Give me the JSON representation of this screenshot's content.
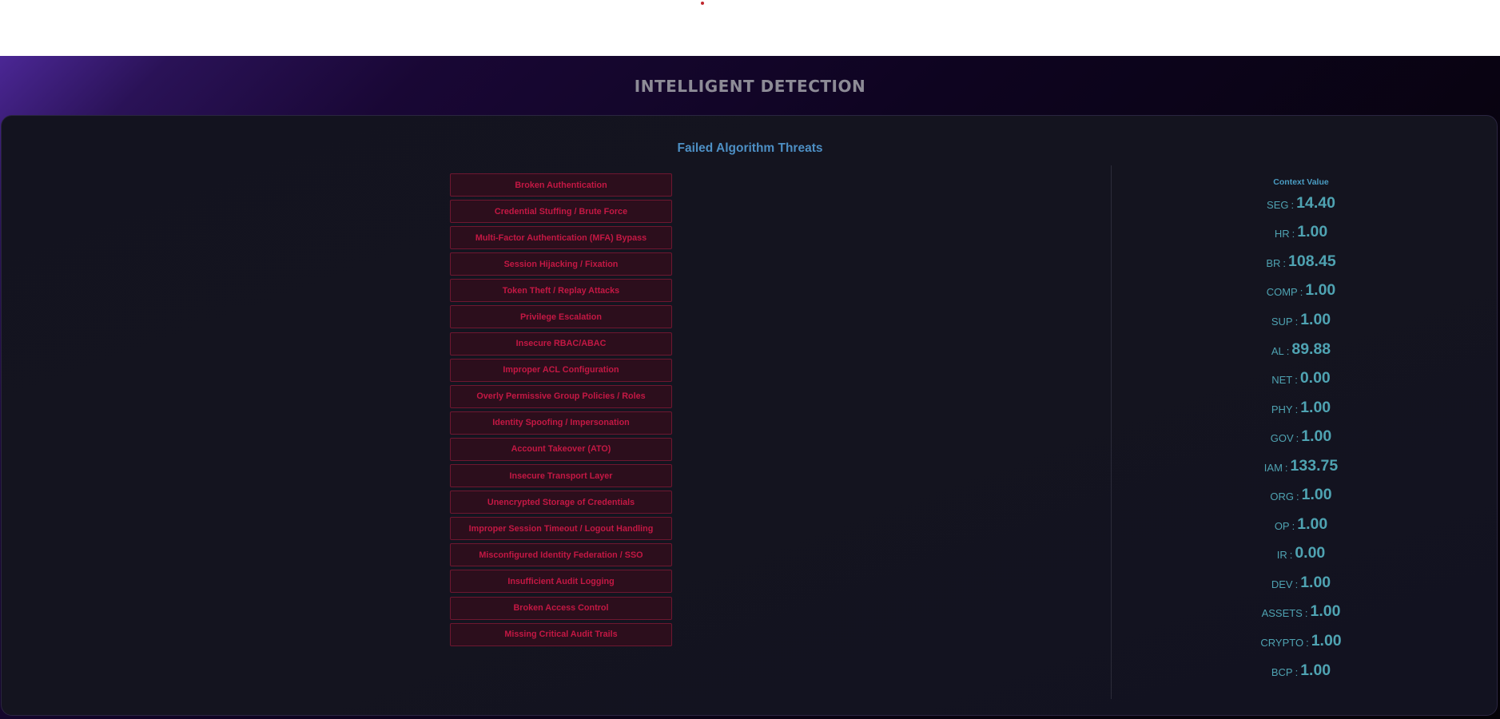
{
  "header": {
    "section_title": "INTELLIGENT DETECTION"
  },
  "panel": {
    "title": "Failed Algorithm Threats",
    "threats": [
      "Broken Authentication",
      "Credential Stuffing / Brute Force",
      "Multi-Factor Authentication (MFA) Bypass",
      "Session Hijacking / Fixation",
      "Token Theft / Replay Attacks",
      "Privilege Escalation",
      "Insecure RBAC/ABAC",
      "Improper ACL Configuration",
      "Overly Permissive Group Policies / Roles",
      "Identity Spoofing / Impersonation",
      "Account Takeover (ATO)",
      "Insecure Transport Layer",
      "Unencrypted Storage of Credentials",
      "Improper Session Timeout / Logout Handling",
      "Misconfigured Identity Federation / SSO",
      "Insufficient Audit Logging",
      "Broken Access Control",
      "Missing Critical Audit Trails"
    ],
    "context": {
      "header": "Context Value",
      "separator": ":",
      "items": [
        {
          "key": "SEG",
          "value": "14.40"
        },
        {
          "key": "HR",
          "value": "1.00"
        },
        {
          "key": "BR",
          "value": "108.45"
        },
        {
          "key": "COMP",
          "value": "1.00"
        },
        {
          "key": "SUP",
          "value": "1.00"
        },
        {
          "key": "AL",
          "value": "89.88"
        },
        {
          "key": "NET",
          "value": "0.00"
        },
        {
          "key": "PHY",
          "value": "1.00"
        },
        {
          "key": "GOV",
          "value": "1.00"
        },
        {
          "key": "IAM",
          "value": "133.75"
        },
        {
          "key": "ORG",
          "value": "1.00"
        },
        {
          "key": "OP",
          "value": "1.00"
        },
        {
          "key": "IR",
          "value": "0.00"
        },
        {
          "key": "DEV",
          "value": "1.00"
        },
        {
          "key": "ASSETS",
          "value": "1.00"
        },
        {
          "key": "CRYPTO",
          "value": "1.00"
        },
        {
          "key": "BCP",
          "value": "1.00"
        }
      ]
    }
  },
  "colors": {
    "threat_text": "#c41844",
    "threat_border": "#6e1730",
    "context_text": "#4fa3b2",
    "panel_title": "#4d8fc4",
    "section_title": "#8d8b96"
  }
}
